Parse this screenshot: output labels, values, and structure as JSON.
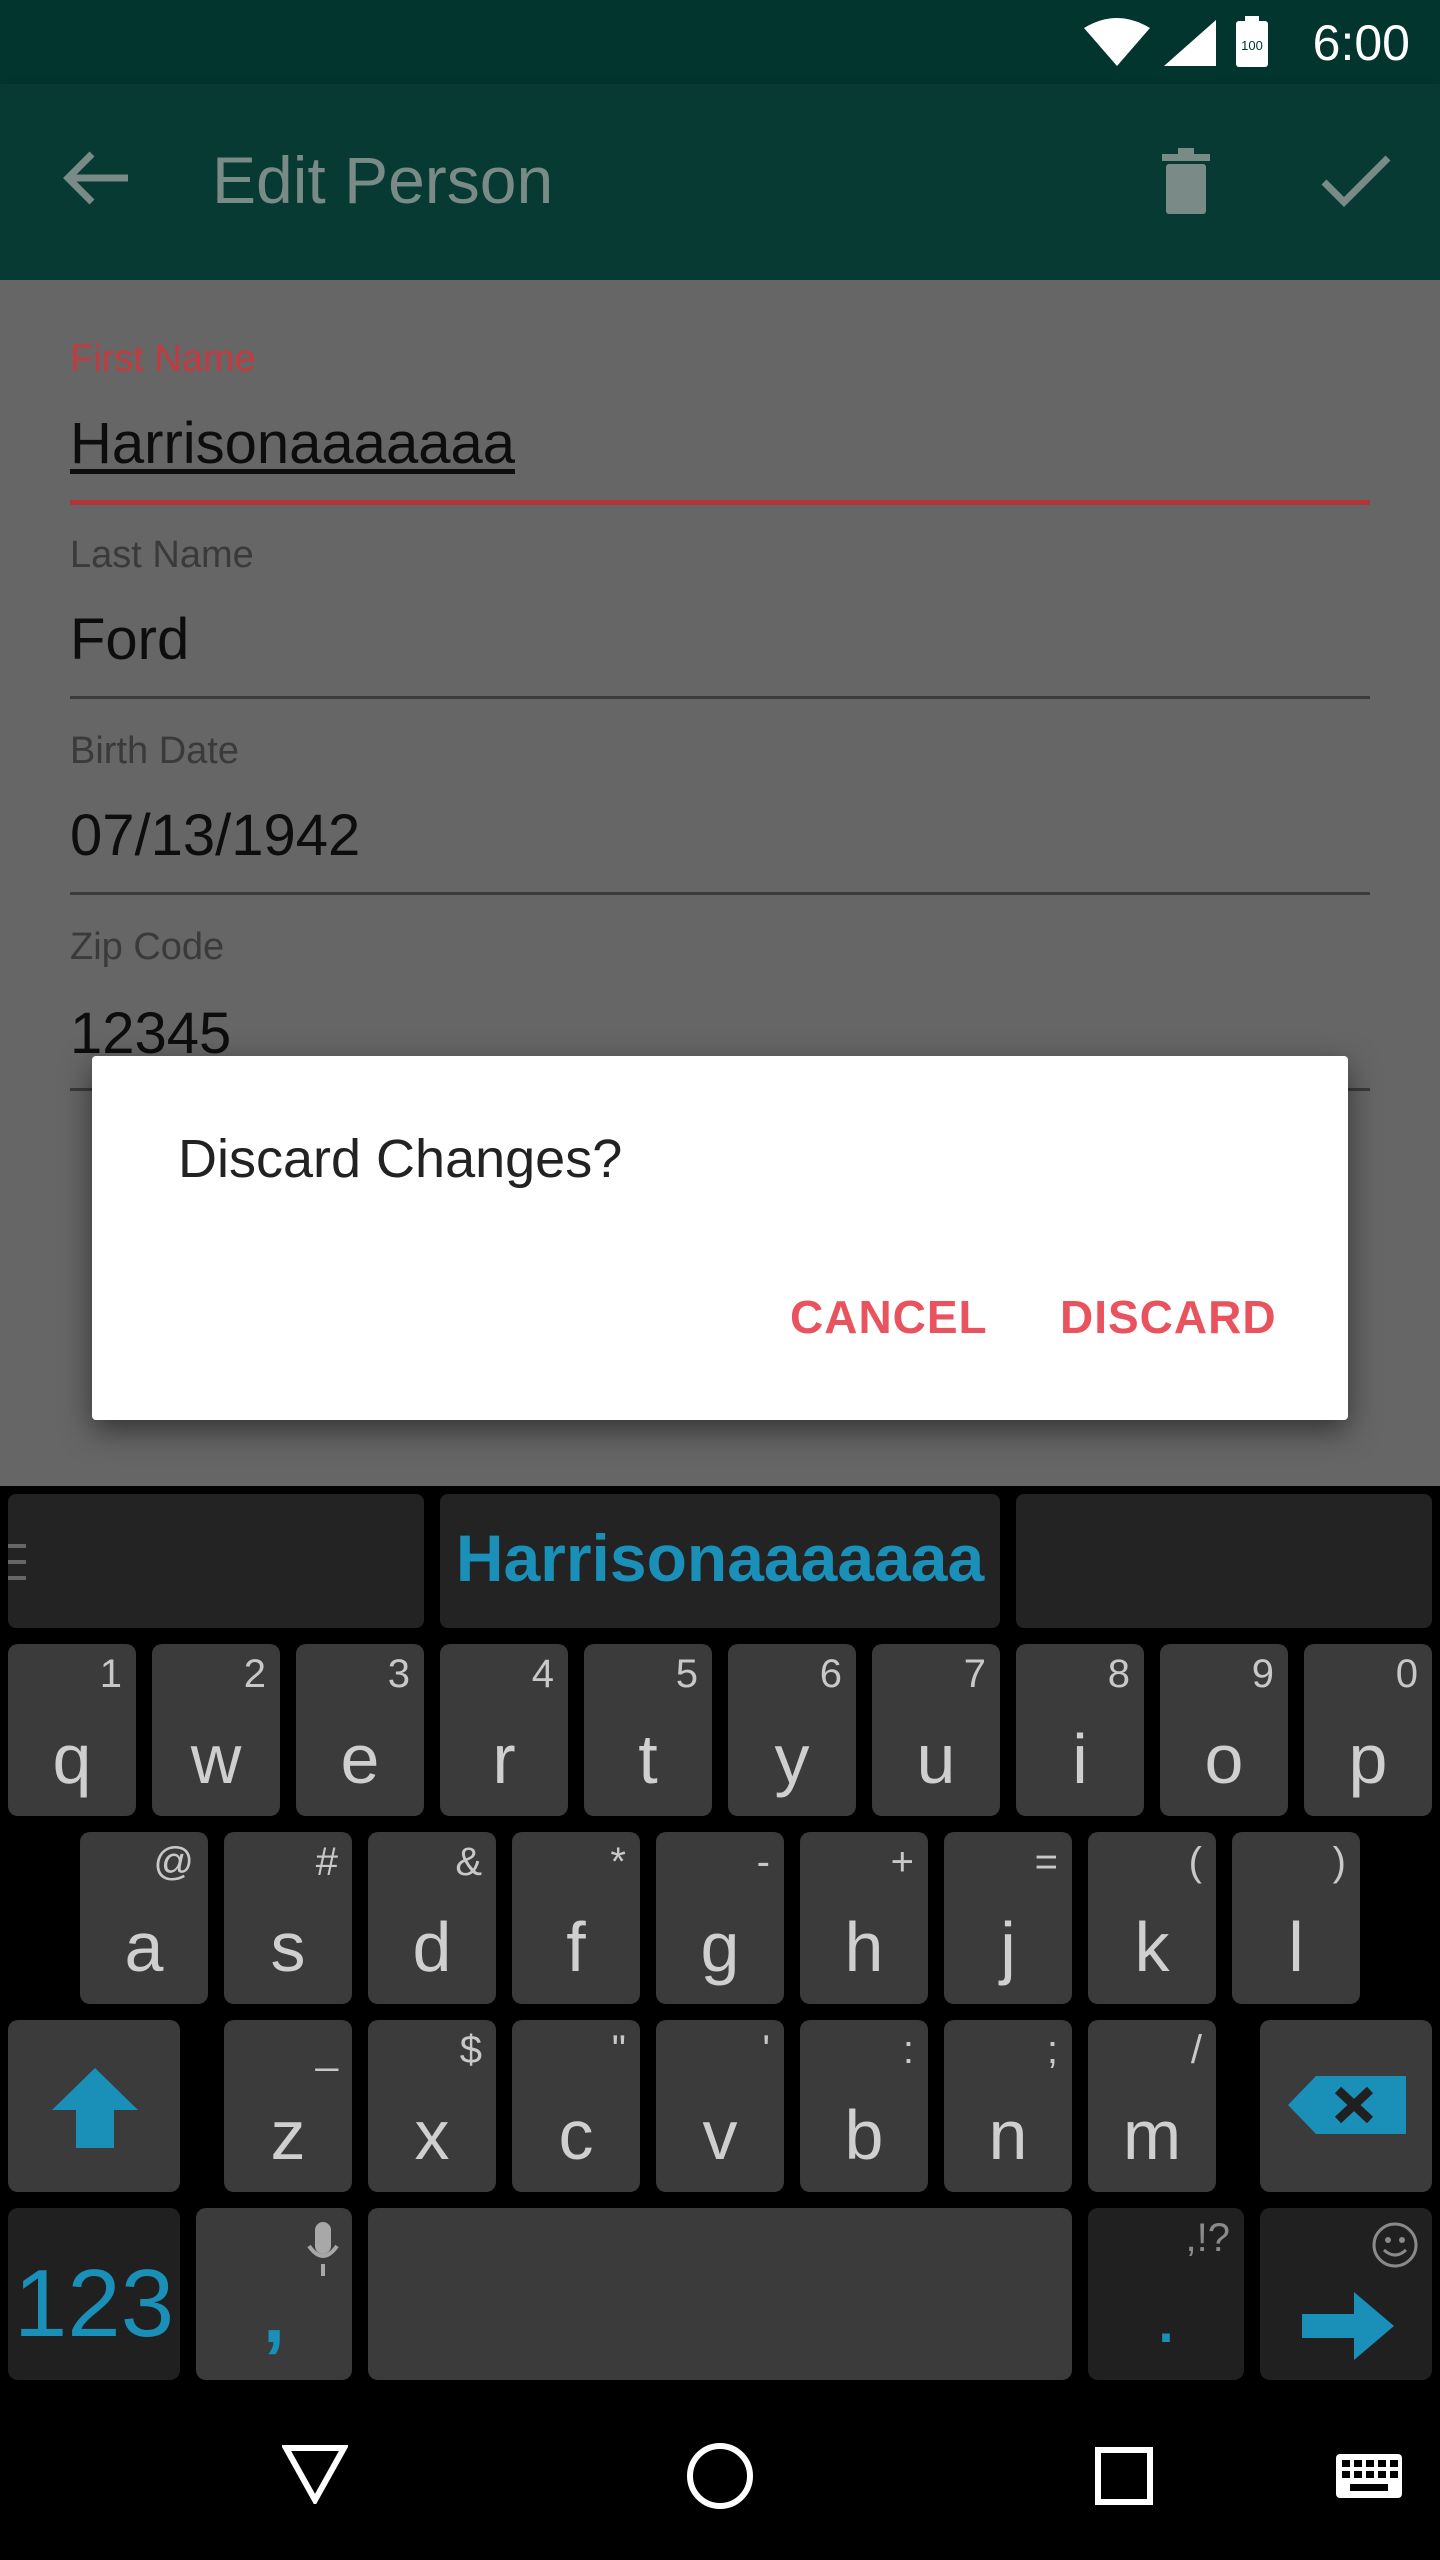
{
  "status_bar": {
    "time": "6:00",
    "battery_level": "100"
  },
  "app_bar": {
    "title": "Edit Person"
  },
  "form": {
    "fields": [
      {
        "label": "First Name",
        "value": "Harrisonaaaaaaa"
      },
      {
        "label": "Last Name",
        "value": "Ford"
      },
      {
        "label": "Birth Date",
        "value": "07/13/1942"
      },
      {
        "label": "Zip Code",
        "value": "12345"
      }
    ]
  },
  "dialog": {
    "title": "Discard Changes?",
    "cancel_label": "CANCEL",
    "discard_label": "DISCARD"
  },
  "keyboard": {
    "suggestion": "Harrisonaaaaaaa",
    "row1": [
      {
        "main": "q",
        "hint": "1"
      },
      {
        "main": "w",
        "hint": "2"
      },
      {
        "main": "e",
        "hint": "3"
      },
      {
        "main": "r",
        "hint": "4"
      },
      {
        "main": "t",
        "hint": "5"
      },
      {
        "main": "y",
        "hint": "6"
      },
      {
        "main": "u",
        "hint": "7"
      },
      {
        "main": "i",
        "hint": "8"
      },
      {
        "main": "o",
        "hint": "9"
      },
      {
        "main": "p",
        "hint": "0"
      }
    ],
    "row2": [
      {
        "main": "a",
        "hint": "@"
      },
      {
        "main": "s",
        "hint": "#"
      },
      {
        "main": "d",
        "hint": "&"
      },
      {
        "main": "f",
        "hint": "*"
      },
      {
        "main": "g",
        "hint": "-"
      },
      {
        "main": "h",
        "hint": "+"
      },
      {
        "main": "j",
        "hint": "="
      },
      {
        "main": "k",
        "hint": "("
      },
      {
        "main": "l",
        "hint": ")"
      }
    ],
    "row3": [
      {
        "main": "z",
        "hint": "_"
      },
      {
        "main": "x",
        "hint": "$"
      },
      {
        "main": "c",
        "hint": "\""
      },
      {
        "main": "v",
        "hint": "'"
      },
      {
        "main": "b",
        "hint": ":"
      },
      {
        "main": "n",
        "hint": ";"
      },
      {
        "main": "m",
        "hint": "/"
      }
    ],
    "numbers_label": "123",
    "comma_label": ",",
    "period_label": ".",
    "period_hint": ",!?"
  },
  "colors": {
    "app_bar": "#073a33",
    "status_bar": "#03352f",
    "accent": "#e8535e",
    "suggestion": "#1a8fb8"
  }
}
